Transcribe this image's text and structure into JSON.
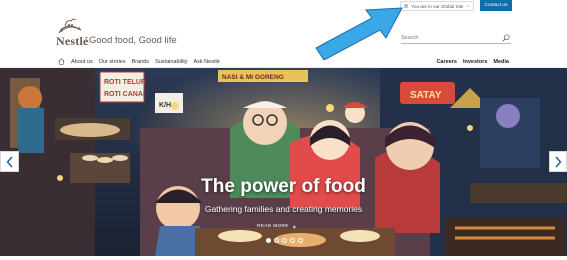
{
  "brand": {
    "logo_text": "Nestlé",
    "tagline": "Good food, Good life"
  },
  "header": {
    "global_site_label": "You are in our Global Site",
    "contact_label": "Contact us",
    "search_placeholder": "Search"
  },
  "nav": {
    "left_items": [
      "About us",
      "Our stories",
      "Brands",
      "Sustainability",
      "Ask Nestlé"
    ],
    "right_items": [
      "Careers",
      "Investors",
      "Media"
    ]
  },
  "hero": {
    "title": "The power of food",
    "subtitle": "Gathering families and creating memories",
    "cta_label": "READ MORE",
    "slide_count": 5,
    "active_slide": 1,
    "signs": {
      "roti_1": "ROTI TELUR",
      "roti_2": "ROTI CANAI",
      "kh": "K/H",
      "nasi": "NASI & MI GORENG",
      "satay": "SATAY"
    }
  },
  "colors": {
    "accent": "#0d6ea8",
    "brand_text": "#6b5a4e",
    "annotation_arrow": "#3aa8e6"
  },
  "icons": [
    "nestle-nest-logo",
    "globe-icon",
    "chevron-down-icon",
    "search-icon",
    "home-icon",
    "arrow-right-icon",
    "chevron-left-icon",
    "chevron-right-icon"
  ]
}
